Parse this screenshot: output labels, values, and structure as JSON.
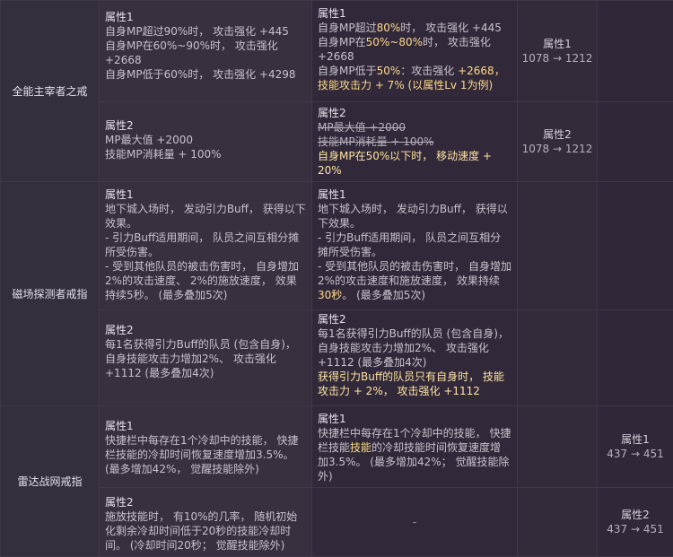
{
  "rows": {
    "r1": {
      "name": "全能主宰者之戒",
      "a1": {
        "title": "属性1",
        "cur": [
          "自身MP超过90%时， 攻击强化 +445",
          "自身MP在60%~90%时， 攻击强化 +2668",
          "自身MP低于60%时， 攻击强化 +4298"
        ],
        "new": {
          "title": "属性1",
          "line1_pre": "自身MP超过",
          "line1_hl": "80%",
          "line1_post": "时， 攻击强化 +445",
          "line2_pre": "自身MP在",
          "line2_hl": "50%~80%",
          "line2_post": "时， 攻击强化 +2668",
          "line3_pre": "自身MP低于",
          "line3_hl": "50%",
          "line3_mid": "：攻击强化 ",
          "line3_hl2": "+2668，技能攻击力 + 7% (以属性Lv 1为例)"
        },
        "stat": {
          "title": "属性1",
          "value": "1078 → 1212"
        }
      },
      "a2": {
        "title": "属性2",
        "cur": [
          "MP最大值 +2000",
          "技能MP消耗量 + 100%"
        ],
        "new": {
          "title": "属性2",
          "strike1": "MP最大值 +2000",
          "strike2": "技能MP消耗量 + 100%",
          "hl": "自身MP在50%以下时， 移动速度 + 20%"
        },
        "stat": {
          "title": "属性2",
          "value": "1078 → 1212"
        }
      }
    },
    "r2": {
      "name": "磁场探测者戒指",
      "a1": {
        "title": "属性1",
        "cur": [
          "地下城入场时， 发动引力Buff， 获得以下效果。",
          "- 引力Buff适用期间， 队员之间互相分摊所受伤害。",
          "- 受到其他队员的被击伤害时， 自身增加2%的攻击速度、 2%的施放速度， 效果持续5秒。 (最多叠加5次)"
        ],
        "new": {
          "title": "属性1",
          "l1": "地下城入场时， 发动引力Buff， 获得以下效果。",
          "l2": "- 引力Buff适用期间， 队员之间互相分摊所受伤害。",
          "l3_pre": "- 受到其他队员的被击伤害时， 自身增加2%的攻击速度和施放速度， 效果持续",
          "l3_hl": "30秒",
          "l3_post": "。 (最多叠加5次)"
        }
      },
      "a2": {
        "title": "属性2",
        "cur": [
          "每1名获得引力Buff的队员 (包含自身)， 自身技能攻击力增加2%、 攻击强化 +1112 (最多叠加4次)"
        ],
        "new": {
          "title": "属性2",
          "l1": "每1名获得引力Buff的队员 (包含自身)， 自身技能攻击力增加2%、 攻击强化 +1112 (最多叠加4次)",
          "hl": "获得引力Buff的队员只有自身时， 技能攻击力 + 2%， 攻击强化 +1112"
        }
      }
    },
    "r3": {
      "name": "雷达战网戒指",
      "a1": {
        "title": "属性1",
        "cur": [
          "快捷栏中每存在1个冷却中的技能， 快捷栏技能的冷却时间恢复速度增加3.5%。 (最多增加42%， 觉醒技能除外)"
        ],
        "new": {
          "title": "属性1",
          "l1_pre": "快捷栏中每存在1个冷却中的技能， 快捷栏技能",
          "l1_hl": "技能",
          "l1_post": "的冷却技能时间恢复速度增加3.5%。 (最多增加42%； 觉醒技能除外)"
        },
        "stat": {
          "title": "属性1",
          "value": "437 → 451"
        }
      },
      "a2": {
        "title": "属性2",
        "cur": [
          "施放技能时， 有10%的几率， 随机初始化剩余冷却时间低于20秒的技能冷却时间。 (冷却时间20秒； 觉醒技能除外)"
        ],
        "new_dash": "-",
        "stat": {
          "title": "属性2",
          "value": "437 → 451"
        }
      }
    }
  }
}
